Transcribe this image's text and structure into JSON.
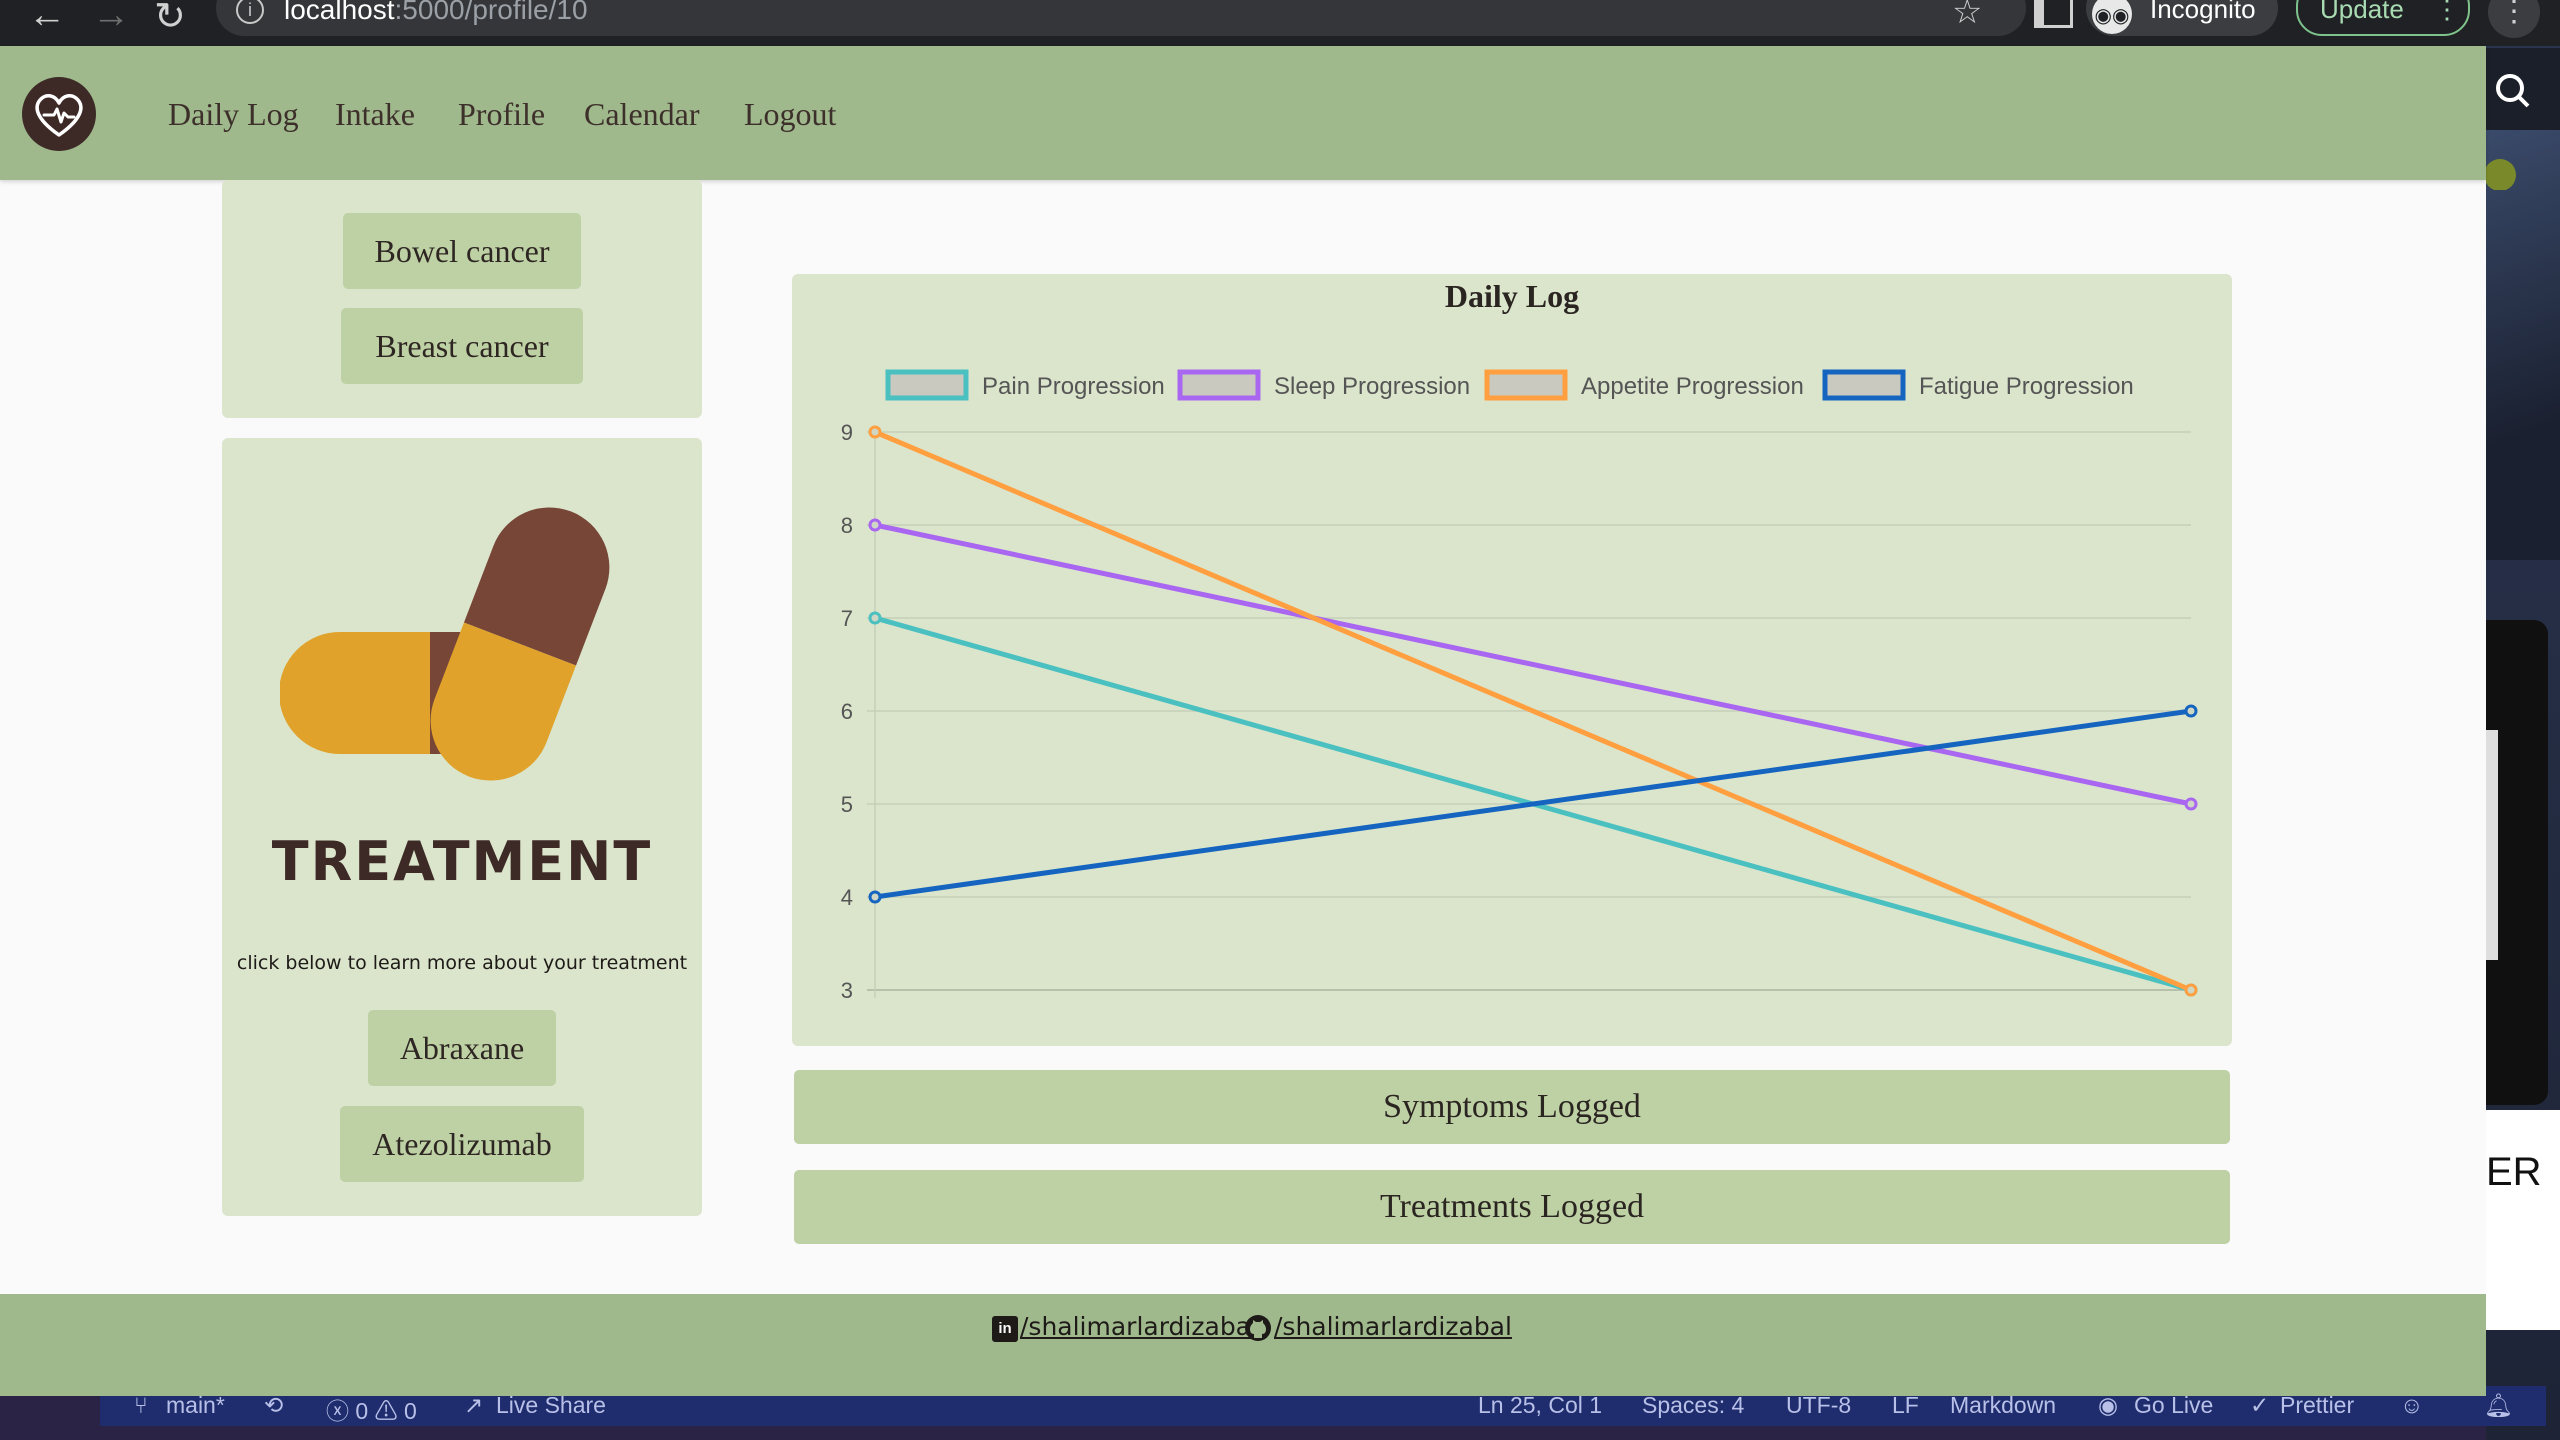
{
  "browser": {
    "url_host": "localhost",
    "url_path": ":5000/profile/10",
    "profile_label": "Incognito",
    "update_label": "Update",
    "back_glyph": "←",
    "forward_glyph": "→",
    "reload_glyph": "↻",
    "star_glyph": "☆",
    "menu_glyph": "⋮"
  },
  "navbar": {
    "links": [
      "Daily Log",
      "Intake",
      "Profile",
      "Calendar",
      "Logout"
    ]
  },
  "diagnosis_card": {
    "buttons": [
      "Bowel cancer",
      "Breast cancer"
    ]
  },
  "treatment_card": {
    "title": "TREATMENT",
    "description": "click below to learn more about your treatment",
    "buttons": [
      "Abraxane",
      "Atezolizumab"
    ]
  },
  "chart_data": {
    "type": "line",
    "title": "Daily Log",
    "x": [
      "",
      ""
    ],
    "ylim": [
      3,
      9
    ],
    "yticks": [
      3,
      4,
      5,
      6,
      7,
      8,
      9
    ],
    "grid": true,
    "legend_position": "top",
    "series": [
      {
        "name": "Pain Progression",
        "values": [
          7,
          3
        ],
        "color": "#4bc0c0"
      },
      {
        "name": "Sleep Progression",
        "values": [
          8,
          5
        ],
        "color": "#a966f0"
      },
      {
        "name": "Appetite Progression",
        "values": [
          9,
          3
        ],
        "color": "#ff9f40"
      },
      {
        "name": "Fatigue Progression",
        "values": [
          4,
          6
        ],
        "color": "#1565c0"
      }
    ]
  },
  "accordions": [
    "Symptoms Logged",
    "Treatments Logged"
  ],
  "footer": {
    "linkedin_handle": "/shalimarlardizabal",
    "github_handle": "/shalimarlardizabal"
  },
  "statusbar": {
    "branch": "main*",
    "sync_glyph": "⟲",
    "problems": "ⓧ 0 ⚠ 0",
    "live_share": "Live Share",
    "position": "Ln 25, Col 1",
    "spaces": "Spaces: 4",
    "encoding": "UTF-8",
    "eol": "LF",
    "language": "Markdown",
    "go_live": "Go Live",
    "prettier": "Prettier"
  },
  "desktop": {
    "partial_text": "ER"
  },
  "colors": {
    "navbar": "#9fb98d",
    "card": "#dbe5cc",
    "button": "#bed1a4",
    "brown": "#3d2a26",
    "pill_orange": "#e0a22a",
    "pill_brown": "#774637"
  }
}
